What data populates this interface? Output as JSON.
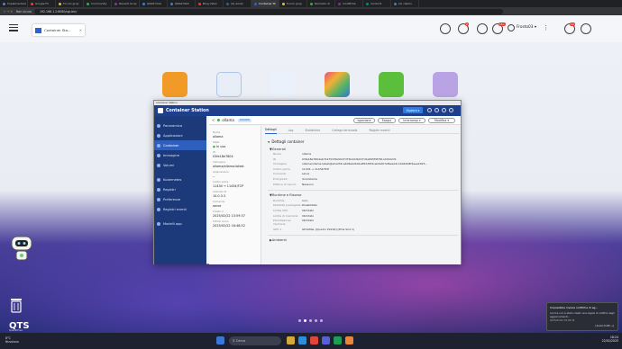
{
  "browser": {
    "tabs": [
      "Implementare",
      "Google Fri",
      "Forum grup",
      "Community",
      "Recenti Grup",
      "QNAP Club",
      "QNAP NAS",
      "Blog Video",
      "(4) email",
      "Container St",
      "forum grup",
      "Remodio di",
      "modifiche",
      "modul R",
      "(2) claims"
    ],
    "active_tab_index": 9,
    "address_warning": "Non sicuro",
    "url": "192.168.1.2:8080/cgi-bin/"
  },
  "qts": {
    "app_chip_label": "Container Sta...",
    "user": "Frosto03",
    "user_chevron": "▾",
    "badges": [
      "2",
      "15+",
      "10"
    ],
    "logo": "QTS",
    "logo_sub": "Quecadrive"
  },
  "window": {
    "titlebar": "Container Station",
    "title": "Container Station",
    "explore_label": "Esplora",
    "explore_chevron": "▾",
    "sidebar": [
      {
        "label": "Panoramica",
        "active": false
      },
      {
        "label": "Applicazioni",
        "active": false
      },
      {
        "label": "Container",
        "active": true
      },
      {
        "label": "Immagine",
        "active": false
      },
      {
        "label": "Volumi",
        "active": false
      },
      {
        "label": "Kubernetes",
        "active": false
      },
      {
        "label": "Registri",
        "active": false
      },
      {
        "label": "Preferenze",
        "active": false
      },
      {
        "label": "Registri eventi",
        "active": false
      },
      {
        "label": "Modelli app",
        "active": false
      }
    ],
    "container": {
      "back": "<",
      "name": "ollama",
      "tag": "DOCKER",
      "actions": [
        "Ispezione",
        "Esegui",
        "Interrompi",
        "Modifica"
      ],
      "action_chevron": "▾"
    },
    "left_info": [
      {
        "k": "Nome",
        "v": "ollama"
      },
      {
        "k": "Stato",
        "v": "In uso"
      },
      {
        "k": "ID",
        "v": "03fe18e7804"
      },
      {
        "k": "Immagine",
        "v": "ollama/ollama:latest"
      },
      {
        "k": "Applicazione",
        "v": "--"
      },
      {
        "k": "Inoltro porta",
        "v": "11434 → 11434/TCP"
      },
      {
        "k": "Indirizzo IP",
        "v": "10.0.3.3"
      },
      {
        "k": "Comando",
        "v": "serve"
      },
      {
        "k": "Creato il",
        "v": "2025/02/22 13:59:37"
      },
      {
        "k": "Ultimo avvio",
        "v": "2025/02/22 16:48:52"
      }
    ],
    "tabs": [
      "Dettagli",
      "Log",
      "Statistiche",
      "Collega terminale",
      "Registri eventi"
    ],
    "active_tab": 0,
    "details": {
      "title": "Dettagli container",
      "generali_title": "Generali",
      "generali": [
        {
          "k": "Nome",
          "v": "ollama"
        },
        {
          "k": "ID",
          "v": "03fe18e7804ab7427033fe99d7d75bd2db0d7d1e895f9f781cdd02231"
        },
        {
          "k": "Immagine",
          "v": "ollama/ollama:latest@sha256:a2b8eb2b91a852d6f4cab3af07ef6ee04c1b94bb8f4eee2923..."
        },
        {
          "k": "Inoltro porta",
          "v": "11434 → 11434/TCP"
        },
        {
          "k": "Comando",
          "v": "serve"
        },
        {
          "k": "Entrypoint",
          "v": "/bin/ollama"
        },
        {
          "k": "Politica di riavvio",
          "v": "Nessuno"
        }
      ],
      "runtime_title": "Runtime e Risorse",
      "runtime": [
        {
          "k": "Runtime",
          "v": "runc"
        },
        {
          "k": "Modalità privilegiate",
          "v": "Disabilitato"
        },
        {
          "k": "Limite CPU",
          "v": "Illimitato"
        },
        {
          "k": "Limite di memoria",
          "v": "Illimitato"
        },
        {
          "k": "Prenotazione memoria",
          "v": "Illimitato"
        },
        {
          "k": "GPU 1",
          "v": "GP106GL [Quadro P2200] (PCIe Slot 1)"
        }
      ],
      "ambienti_title": "Ambienti"
    }
  },
  "taskbar": {
    "weather_temp": "8°C",
    "weather_desc": "Nuvoloso",
    "search": "Cerca",
    "time": "18:24",
    "date": "22/02/2025"
  },
  "toast": {
    "title": "Impossibile inviare notifiche di ag...",
    "body": "Ancora non è stato creato una regola di notifica degli aggiornamenti...",
    "time": "2025/02/22 18:06:34",
    "action": "[Avvisi tratti →]"
  },
  "colors": {
    "qnap_blue": "#1d3f8c",
    "active_blue": "#2f5fbd",
    "running_green": "#3bb54a",
    "explore_blue": "#2d7be3"
  }
}
